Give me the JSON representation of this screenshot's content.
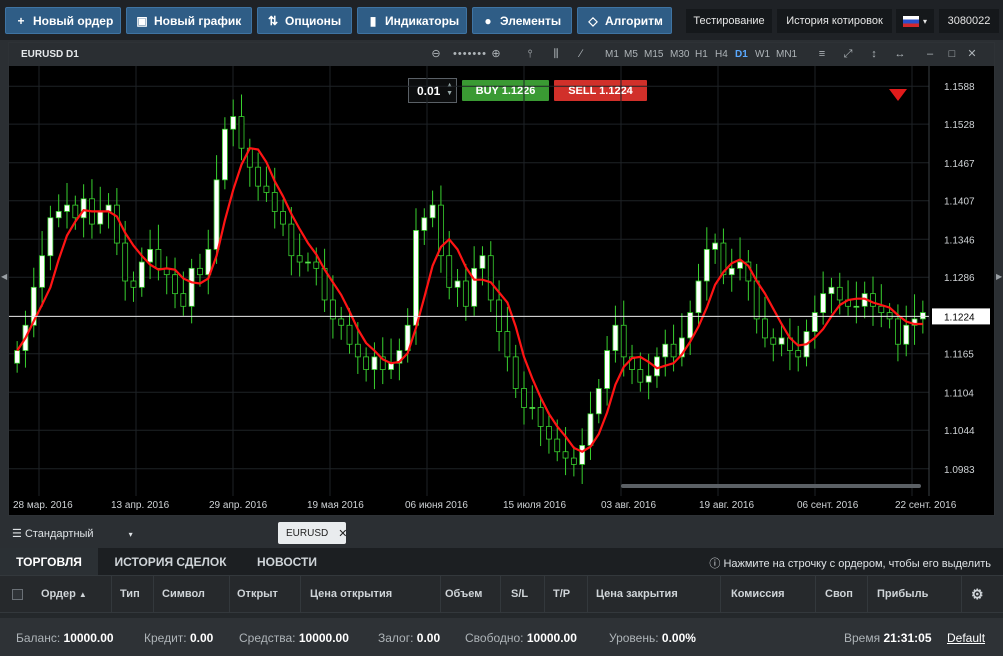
{
  "toolbar": {
    "new_order": "Новый ордер",
    "new_chart": "Новый график",
    "options": "Опционы",
    "indicators": "Индикаторы",
    "elements": "Элементы",
    "algorithm": "Алгоритм",
    "testing": "Тестирование",
    "quote_history": "История котировок",
    "flag_icon": "russia-flag-icon",
    "account_number": "3080022"
  },
  "chart_window": {
    "title": "EURUSD D1",
    "timeframes": [
      "M1",
      "M5",
      "M15",
      "M30",
      "H1",
      "H4",
      "D1",
      "W1",
      "MN1"
    ],
    "active_timeframe": "D1",
    "lot_value": "0.01",
    "buy_label": "BUY 1.1226",
    "sell_label": "SELL 1.1224"
  },
  "chart_data": {
    "type": "candlestick",
    "symbol": "EURUSD",
    "timeframe": "D1",
    "y_ticks": [
      "1.1588",
      "1.1528",
      "1.1467",
      "1.1407",
      "1.1346",
      "1.1286",
      "1.1224",
      "1.1165",
      "1.1104",
      "1.1044",
      "1.0983"
    ],
    "current_price": "1.1224",
    "x_ticks": [
      "28 мар. 2016",
      "13 апр. 2016",
      "29 апр. 2016",
      "19 мая 2016",
      "06 июня 2016",
      "15 июля 2016",
      "03 авг. 2016",
      "19 авг. 2016",
      "06 сент. 2016",
      "22 сент. 2016"
    ],
    "closes": [
      1.117,
      1.121,
      1.127,
      1.132,
      1.138,
      1.139,
      1.14,
      1.138,
      1.141,
      1.137,
      1.139,
      1.14,
      1.134,
      1.128,
      1.127,
      1.131,
      1.133,
      1.13,
      1.129,
      1.126,
      1.124,
      1.13,
      1.129,
      1.133,
      1.144,
      1.152,
      1.154,
      1.149,
      1.146,
      1.143,
      1.142,
      1.139,
      1.137,
      1.132,
      1.131,
      1.131,
      1.13,
      1.125,
      1.122,
      1.121,
      1.118,
      1.116,
      1.114,
      1.116,
      1.114,
      1.115,
      1.117,
      1.121,
      1.136,
      1.138,
      1.14,
      1.132,
      1.127,
      1.128,
      1.124,
      1.13,
      1.132,
      1.125,
      1.12,
      1.116,
      1.111,
      1.108,
      1.108,
      1.105,
      1.103,
      1.101,
      1.1,
      1.099,
      1.102,
      1.107,
      1.111,
      1.117,
      1.121,
      1.116,
      1.114,
      1.112,
      1.113,
      1.116,
      1.118,
      1.116,
      1.119,
      1.123,
      1.128,
      1.133,
      1.134,
      1.129,
      1.13,
      1.131,
      1.128,
      1.122,
      1.119,
      1.118,
      1.119,
      1.117,
      1.116,
      1.12,
      1.123,
      1.126,
      1.127,
      1.125,
      1.124,
      1.124,
      1.126,
      1.124,
      1.123,
      1.122,
      1.118,
      1.121,
      1.122,
      1.123
    ],
    "moving_average": "red"
  },
  "bottom_tabs": {
    "template_label": "Стандартный",
    "symbol_tab": "EURUSD"
  },
  "terminal": {
    "tabs": [
      "ТОРГОВЛЯ",
      "ИСТОРИЯ СДЕЛОК",
      "НОВОСТИ"
    ],
    "hint": "Нажмите на строчку с ордером, чтобы его выделить",
    "columns": [
      "Ордер",
      "Тип",
      "Символ",
      "Открыт",
      "Цена открытия",
      "Объем",
      "S/L",
      "T/P",
      "Цена закрытия",
      "Комиссия",
      "Своп",
      "Прибыль"
    ],
    "status": {
      "balance_label": "Баланс:",
      "balance": "10000.00",
      "credit_label": "Кредит:",
      "credit": "0.00",
      "equity_label": "Средства:",
      "equity": "10000.00",
      "margin_label": "Залог:",
      "margin": "0.00",
      "free_label": "Свободно:",
      "free": "10000.00",
      "level_label": "Уровень:",
      "level": "0.00%",
      "time_label": "Время",
      "time": "21:31:05",
      "profile": "Default"
    }
  }
}
